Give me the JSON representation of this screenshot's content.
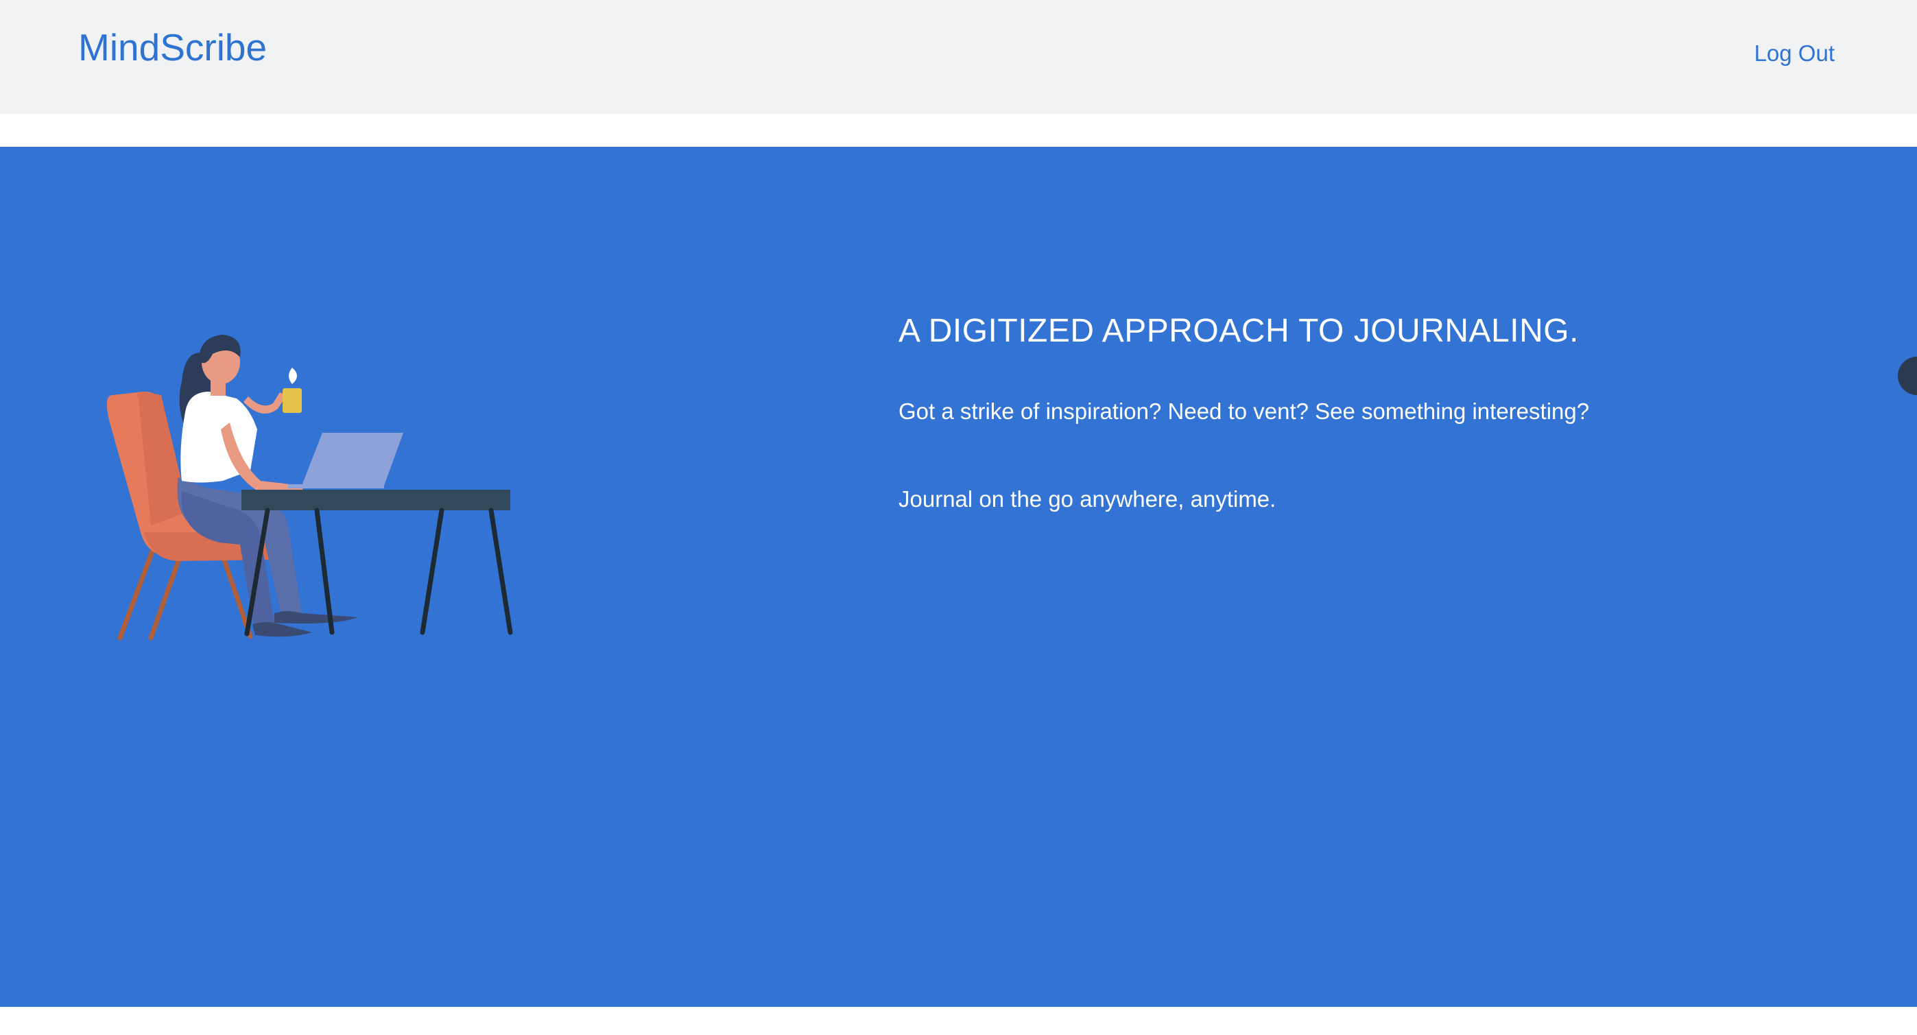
{
  "navbar": {
    "brand": "MindScribe",
    "logout_label": "Log Out"
  },
  "hero": {
    "headline": "A DIGITIZED APPROACH TO JOURNALING.",
    "paragraph_1": "Got a strike of inspiration? Need to vent? See something interesting?",
    "paragraph_2": "Journal on the go anywhere, anytime."
  },
  "colors": {
    "brand": "#2f73d2",
    "navbar_background": "#f1f2f4",
    "hero_background": "#3273d4",
    "hero_text": "#ffffff"
  },
  "icons": {
    "illustration": "woman-at-desk-illustration",
    "edge": "floating-circle-icon"
  }
}
